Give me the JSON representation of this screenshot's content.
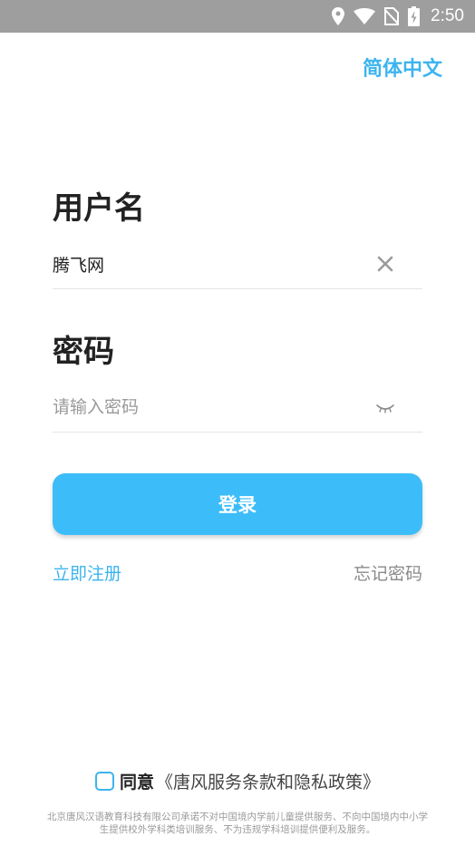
{
  "status_bar": {
    "time": "2:50",
    "icons": [
      "location-icon",
      "wifi-icon",
      "no-sim-icon",
      "battery-charging-icon"
    ]
  },
  "language_selector": "简体中文",
  "username": {
    "label": "用户名",
    "value": "腾飞网",
    "clear_icon": "close-icon"
  },
  "password": {
    "label": "密码",
    "placeholder": "请输入密码",
    "visibility_icon": "eye-closed-icon"
  },
  "login_button": "登录",
  "register_link": "立即注册",
  "forgot_link": "忘记密码",
  "agreement": {
    "agree_text": "同意",
    "policy_link": "《唐风服务条款和隐私政策》"
  },
  "footer_note": "北京唐风汉语教育科技有限公司承诺不对中国境内学前儿童提供服务、不向中国境内中小学生提供校外学科类培训服务、不为违规学科培训提供便利及服务。",
  "colors": {
    "accent": "#3cb4ee",
    "button": "#3cbdf9",
    "status_bar": "#9e9e9e"
  }
}
